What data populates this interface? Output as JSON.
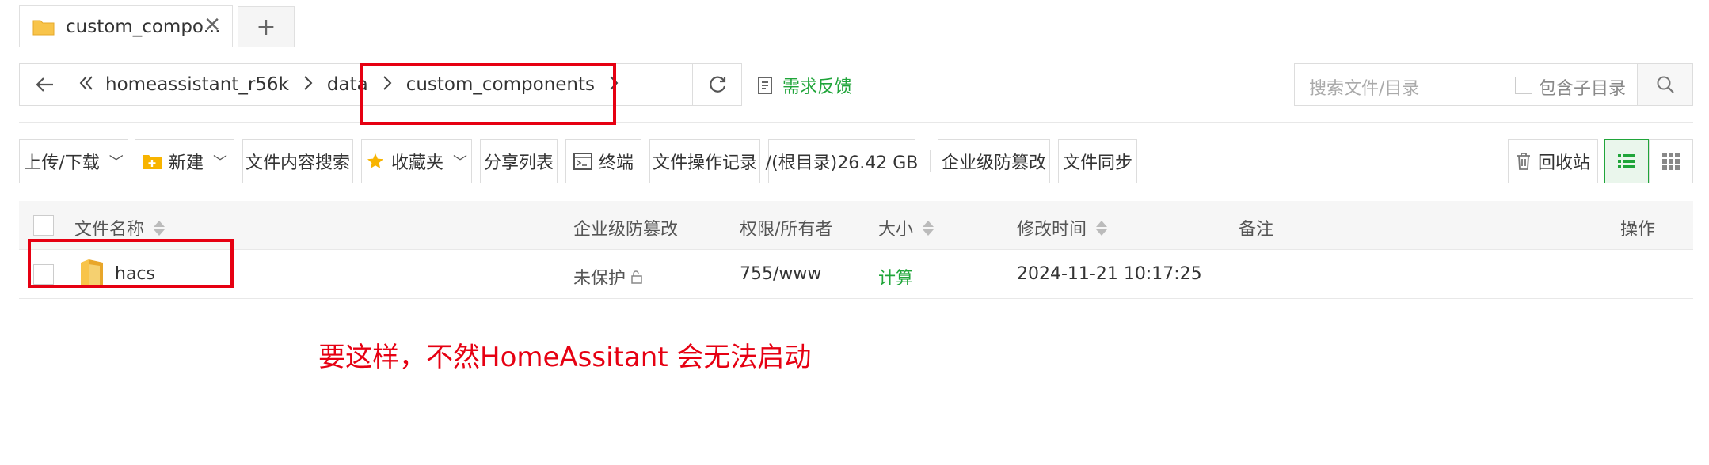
{
  "tabs": [
    {
      "label": "custom_compo..."
    }
  ],
  "address": {
    "breadcrumbs": [
      "homeassistant_r56k",
      "data",
      "custom_components"
    ]
  },
  "feedback_label": "需求反馈",
  "search": {
    "placeholder": "搜索文件/目录",
    "include_subdir_label": "包含子目录"
  },
  "toolbar": {
    "upload": "上传/下载",
    "new": "新建",
    "content_search": "文件内容搜索",
    "favorites": "收藏夹",
    "share_list": "分享列表",
    "terminal": "终端",
    "op_log": "文件操作记录",
    "disk": "/(根目录)26.42 GB",
    "tamper": "企业级防篡改",
    "sync": "文件同步",
    "recycle": "回收站"
  },
  "table": {
    "headers": {
      "name": "文件名称",
      "tamper": "企业级防篡改",
      "perm": "权限/所有者",
      "size": "大小",
      "mtime": "修改时间",
      "note": "备注",
      "ops": "操作"
    },
    "rows": [
      {
        "name": "hacs",
        "tamper": "未保护",
        "perm": "755/www",
        "size": "计算",
        "mtime": "2024-11-21 10:17:25",
        "note": ""
      }
    ]
  },
  "annotation_text": "要这样，不然HomeAssitant 会无法启动",
  "colors": {
    "accent": "#20a53a",
    "annotation": "#e60012",
    "folder": "#f8c44a"
  },
  "icons": [
    "folder-icon",
    "close-icon",
    "plus-icon",
    "back-arrow-icon",
    "double-chevron-left-icon",
    "chevron-right-icon",
    "refresh-icon",
    "feedback-icon",
    "search-icon",
    "new-folder-icon",
    "star-icon",
    "terminal-icon",
    "trash-icon",
    "list-view-icon",
    "grid-view-icon",
    "lock-open-icon"
  ]
}
